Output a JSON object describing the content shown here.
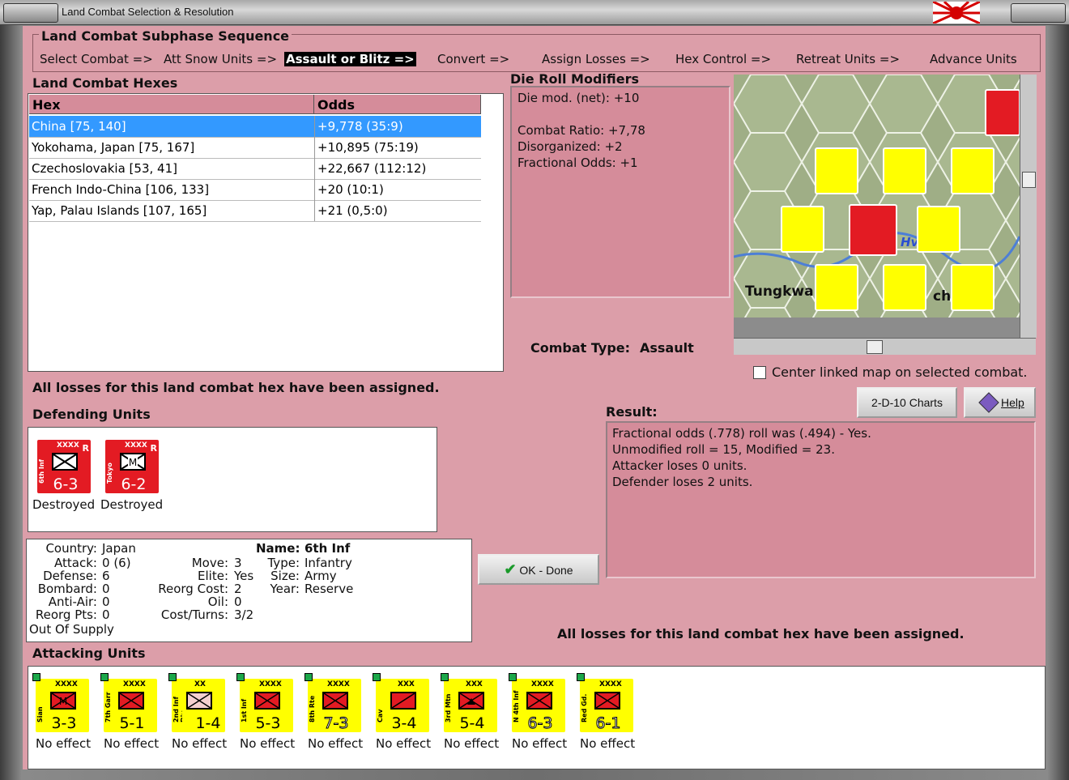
{
  "window": {
    "title": "Land Combat Selection & Resolution"
  },
  "sequence": {
    "title": "Land Combat Subphase Sequence",
    "steps": [
      {
        "label": "Select Combat =>"
      },
      {
        "label": "Att Snow Units =>"
      },
      {
        "label": "Assault or Blitz =>"
      },
      {
        "label": "Convert =>"
      },
      {
        "label": "Assign Losses =>"
      },
      {
        "label": "Hex Control =>"
      },
      {
        "label": "Retreat Units =>"
      },
      {
        "label": "Advance Units"
      }
    ],
    "active_index": 2
  },
  "hexes": {
    "title": "Land Combat Hexes",
    "columns": [
      "Hex",
      "Odds"
    ],
    "rows": [
      {
        "hex": "China [75, 140]",
        "odds": "+9,778 (35:9)"
      },
      {
        "hex": "Yokohama, Japan [75, 167]",
        "odds": "+10,895 (75:19)"
      },
      {
        "hex": "Czechoslovakia [53, 41]",
        "odds": "+22,667 (112:12)"
      },
      {
        "hex": "French Indo-China [106, 133]",
        "odds": "+20 (10:1)"
      },
      {
        "hex": "Yap, Palau Islands [107, 165]",
        "odds": "+21 (0,5:0)"
      }
    ],
    "selected_index": 0
  },
  "die_roll": {
    "title": "Die Roll Modifiers",
    "lines": [
      "Die mod. (net): +10",
      "",
      "Combat Ratio: +7,78",
      "Disorganized: +2",
      "Fractional Odds: +1"
    ]
  },
  "combat_type": {
    "label": "Combat Type:",
    "value": "Assault"
  },
  "center_map": {
    "label": "Center linked map on selected combat.",
    "checked": false
  },
  "map": {
    "place_label": "Tungkwa",
    "place_label_2": "ch",
    "place_label_3": "Hv"
  },
  "losses_status": "All losses for this land combat hex have been assigned.",
  "defending": {
    "title": "Defending Units",
    "units": [
      {
        "side": "6th Inf",
        "size": "XXXX",
        "strength": "6-3",
        "badge": "R",
        "symbol": "",
        "status": "Destroyed"
      },
      {
        "side": "Tokyo",
        "size": "XXXX",
        "strength": "6-2",
        "badge": "R",
        "symbol": "M",
        "status": "Destroyed"
      }
    ]
  },
  "unit_info": {
    "country_label": "Country:",
    "country": "Japan",
    "attack_label": "Attack:",
    "attack": "0",
    "attack_extra": "(6)",
    "defense_label": "Defense:",
    "defense": "6",
    "bombard_label": "Bombard:",
    "bombard": "0",
    "antiair_label": "Anti-Air:",
    "antiair": "0",
    "reorg_label": "Reorg Pts:",
    "reorg": "0",
    "supply": "Out Of Supply",
    "move_label": "Move:",
    "move": "3",
    "elite_label": "Elite:",
    "elite": "Yes",
    "reorg_cost_label": "Reorg Cost:",
    "reorg_cost": "2",
    "oil_label": "Oil:",
    "oil": "0",
    "cost_label": "Cost/Turns:",
    "cost": "3/2",
    "name_label": "Name:",
    "name": "6th Inf",
    "type_label": "Type:",
    "type": "Infantry",
    "size_label": "Size:",
    "size": "Army",
    "year_label": "Year:",
    "year": "Reserve"
  },
  "buttons": {
    "ok": "OK - Done",
    "charts": "2-D-10 Charts",
    "help": "Help"
  },
  "result": {
    "title": "Result:",
    "lines": [
      "Fractional odds (.778) roll was (.494)  - Yes.",
      "Unmodified roll = 15, Modified = 23.",
      "Attacker loses 0 units.",
      "Defender loses 2 units."
    ]
  },
  "attacking": {
    "title": "Attacking Units",
    "units": [
      {
        "side": "Sian",
        "size": "XXXX",
        "strength": "3-3",
        "symbol": "M",
        "status": "No effect"
      },
      {
        "side": "7th Garr",
        "size": "XXXX",
        "strength": "5-1",
        "symbol": "",
        "status": "No effect"
      },
      {
        "side": "2nd Inf Div",
        "size": "XX",
        "strength": "1-4",
        "symbol": "",
        "status": "No effect"
      },
      {
        "side": "1st Inf",
        "size": "XXXX",
        "strength": "5-3",
        "symbol": "",
        "status": "No effect"
      },
      {
        "side": "8th Rte",
        "size": "XXXX",
        "strength": "7-3",
        "symbol": "",
        "status": "No effect"
      },
      {
        "side": "Cav",
        "size": "XXX",
        "strength": "3-4",
        "symbol": "",
        "status": "No effect"
      },
      {
        "side": "3rd Mtn",
        "size": "XXX",
        "strength": "5-4",
        "symbol": "",
        "status": "No effect"
      },
      {
        "side": "N 4th Inf",
        "size": "XXXX",
        "strength": "6-3",
        "symbol": "",
        "status": "No effect"
      },
      {
        "side": "Red Gd.",
        "size": "XXXX",
        "strength": "6-1",
        "symbol": "",
        "status": "No effect"
      }
    ]
  },
  "colors": {
    "client_bg": "#dc9ea9",
    "panel_pink": "#d58c9a",
    "selection": "#3399ff",
    "unit_red": "#e31b23",
    "unit_yellow": "#ffff00"
  }
}
